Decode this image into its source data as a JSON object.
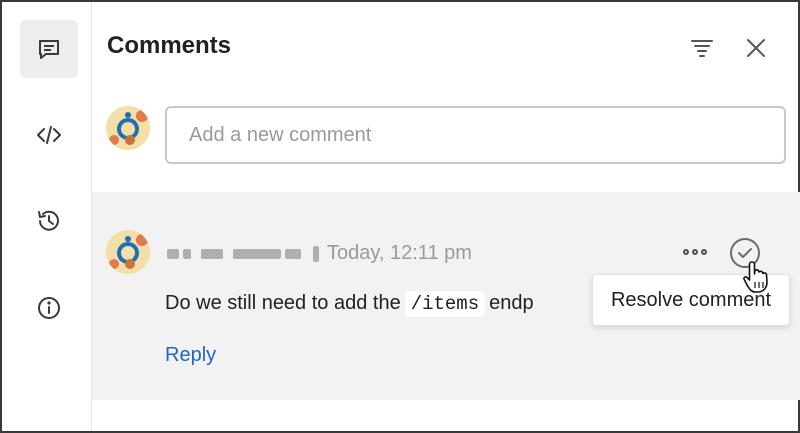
{
  "panel": {
    "title": "Comments"
  },
  "rail": {
    "items": [
      {
        "icon": "comment-icon",
        "active": true
      },
      {
        "icon": "code-icon",
        "active": false
      },
      {
        "icon": "history-icon",
        "active": false
      },
      {
        "icon": "info-icon",
        "active": false
      }
    ]
  },
  "header": {
    "filter_icon": "filter-icon",
    "close_icon": "close-icon"
  },
  "new_comment": {
    "placeholder": "Add a new comment"
  },
  "comment": {
    "timestamp": "Today, 12:11 pm",
    "text_before": "Do we still need to add the",
    "code": "/items",
    "text_after": "endp",
    "reply_label": "Reply"
  },
  "tooltip": {
    "text": "Resolve comment"
  },
  "colors": {
    "accent": "#2166c0",
    "card_bg": "#f2f2f2",
    "avatar_bg": "#f3dfa8"
  }
}
